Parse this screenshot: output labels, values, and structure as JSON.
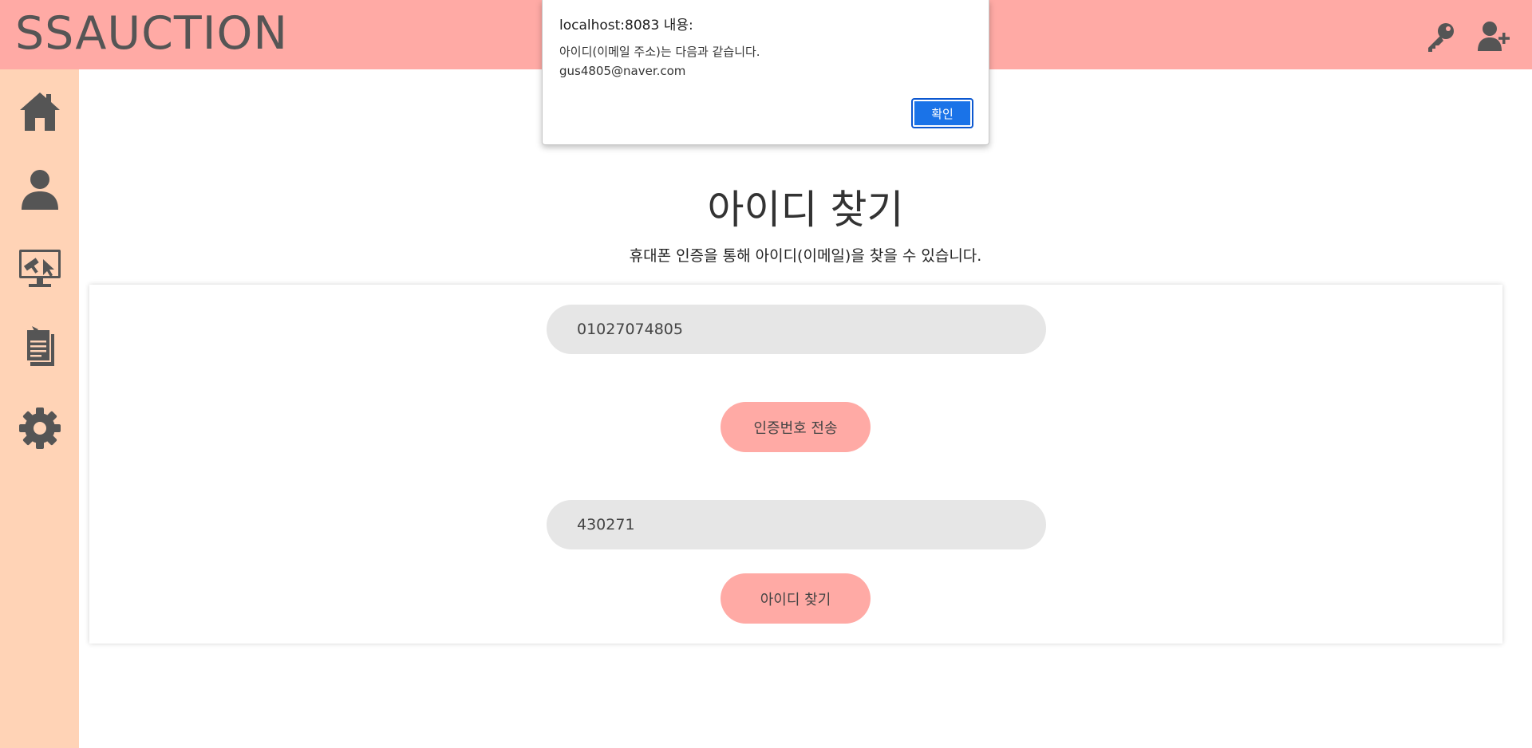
{
  "header": {
    "brand": "SSAUCTION",
    "icons": [
      "key-icon",
      "user-plus-icon"
    ]
  },
  "sidebar": {
    "items": [
      {
        "icon": "home-icon"
      },
      {
        "icon": "user-icon"
      },
      {
        "icon": "auction-monitor-icon"
      },
      {
        "icon": "clipboard-icon"
      },
      {
        "icon": "gear-icon"
      }
    ]
  },
  "main": {
    "title": "아이디 찾기",
    "subtitle": "휴대폰 인증을 통해 아이디(이메일)을 찾을 수 있습니다.",
    "phone_value": "01027074805",
    "send_code_label": "인증번호 전송",
    "code_value": "430271",
    "find_id_label": "아이디 찾기"
  },
  "dialog": {
    "title": "localhost:8083 내용:",
    "message_line1": "아이디(이메일 주소)는 다음과 같습니다.",
    "message_line2": "gus4805@naver.com",
    "ok_label": "확인"
  },
  "colors": {
    "header_bg": "#ffaaa5",
    "sidebar_bg": "#ffd3b6",
    "icon_gray": "#555555",
    "field_bg": "#e6e6e6",
    "dialog_button": "#1a73e8"
  }
}
